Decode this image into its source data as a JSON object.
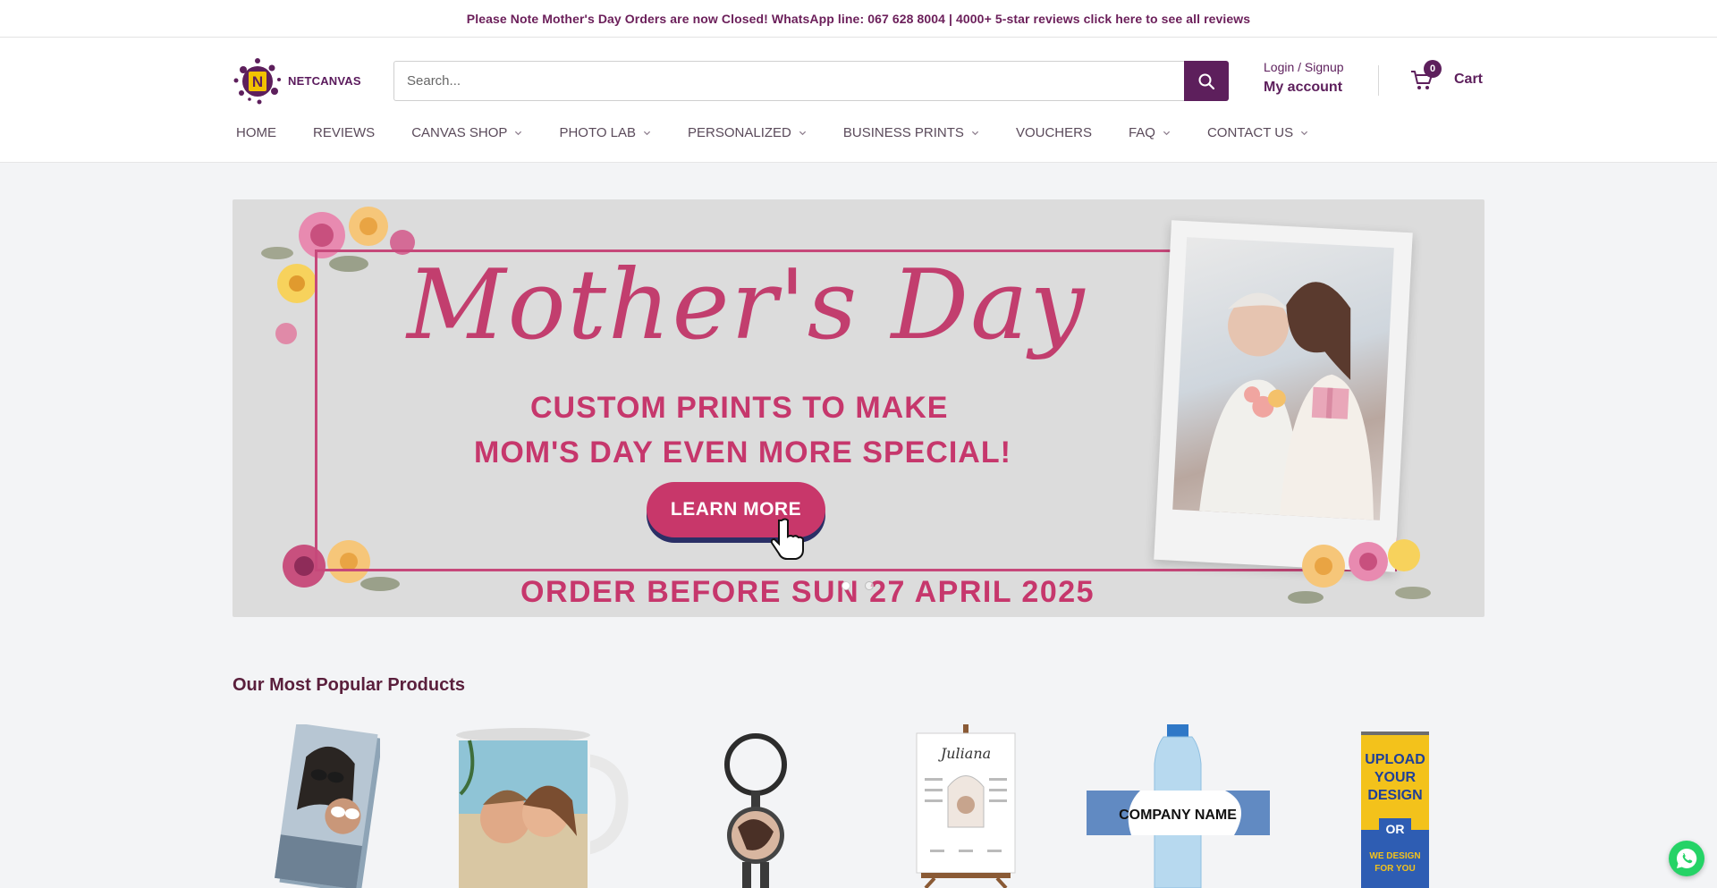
{
  "announcement": "Please Note Mother's Day Orders are now Closed! WhatsApp line: 067 628 8004 | 4000+ 5-star reviews click here to see all reviews",
  "logo": {
    "text": "NETCANVAS",
    "letter": "N"
  },
  "search": {
    "placeholder": "Search..."
  },
  "account": {
    "login": "Login / Signup",
    "my_account": "My account"
  },
  "cart": {
    "label": "Cart",
    "count": "0"
  },
  "nav": [
    {
      "label": "HOME",
      "dropdown": false
    },
    {
      "label": "REVIEWS",
      "dropdown": false
    },
    {
      "label": "CANVAS SHOP",
      "dropdown": true
    },
    {
      "label": "PHOTO LAB",
      "dropdown": true
    },
    {
      "label": "PERSONALIZED",
      "dropdown": true
    },
    {
      "label": "BUSINESS PRINTS",
      "dropdown": true
    },
    {
      "label": "VOUCHERS",
      "dropdown": false
    },
    {
      "label": "FAQ",
      "dropdown": true
    },
    {
      "label": "CONTACT US",
      "dropdown": true
    }
  ],
  "hero": {
    "script_title": "Mother's Day",
    "subtitle_line1": "CUSTOM PRINTS TO MAKE",
    "subtitle_line2": "MOM'S DAY EVEN MORE SPECIAL!",
    "cta": "LEARN MORE",
    "footer": "ORDER BEFORE SUN 27 APRIL 2025",
    "active_slide": 1,
    "slide_count": 2
  },
  "popular": {
    "title": "Our Most Popular Products",
    "items": [
      {
        "kind": "photo-tile"
      },
      {
        "kind": "photo-mug"
      },
      {
        "kind": "photo-keyring"
      },
      {
        "kind": "poster-easel",
        "caption": "Juliana"
      },
      {
        "kind": "water-bottle-label",
        "caption": "COMPANY NAME"
      },
      {
        "kind": "pull-up-banner",
        "lines": [
          "UPLOAD",
          "YOUR",
          "DESIGN",
          "OR",
          "WE DESIGN",
          "FOR YOU"
        ]
      }
    ]
  },
  "colors": {
    "brand": "#5d1f5c",
    "hero_pink": "#c6376c",
    "whatsapp": "#25d366"
  }
}
